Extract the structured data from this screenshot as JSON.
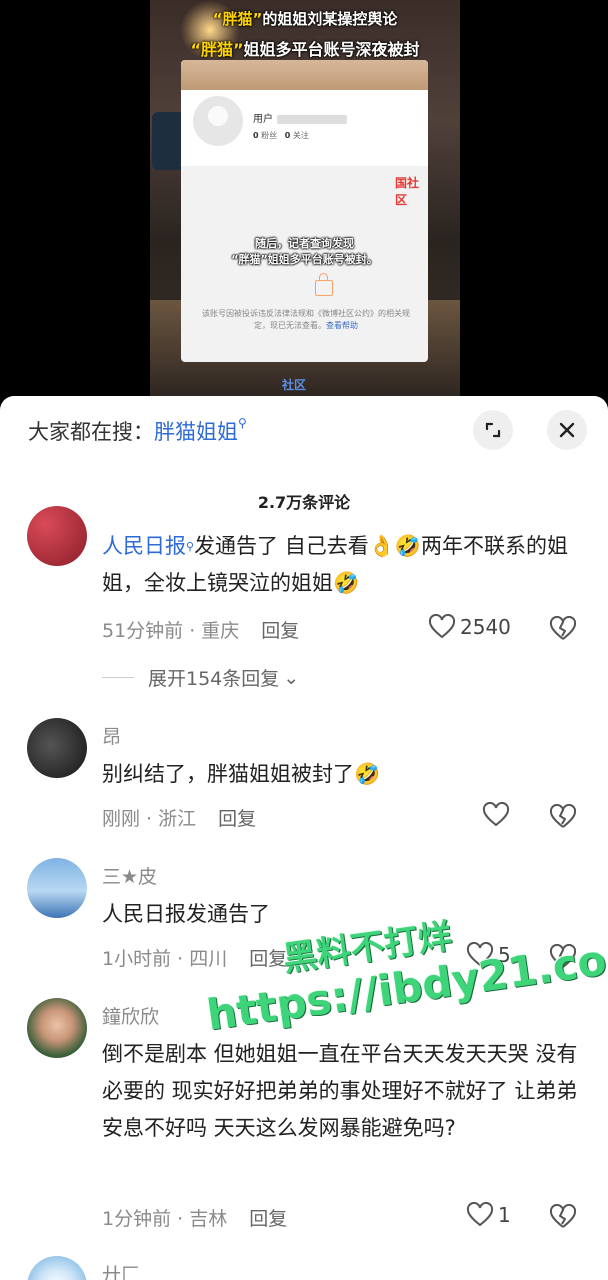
{
  "video": {
    "headline_line1_hl": "“胖猫”",
    "headline_line1_rest": "的姐姐刘某操控舆论",
    "headline_line2_hl": "“胖猫”",
    "headline_line2_rest": "姐姐多平台账号深夜被封",
    "card_user_label": "用户",
    "card_followers": "0",
    "card_followers_label": "粉丝",
    "card_following": "0",
    "card_following_label": "关注",
    "card_logo": "国社区",
    "card_subtitle_line1": "随后，记者查询发现",
    "card_subtitle_line2": "“胖猫”姐姐多平台账号被封。",
    "card_notice": "该账号因被投诉违反法律法规和《微博社区公约》的相关规定，现已无法查看。",
    "card_notice_link": "查看帮助",
    "bottom_mark": "社区"
  },
  "search": {
    "prefix": "大家都在搜：",
    "keyword": "胖猫姐姐"
  },
  "comments_count": "2.7万条评论",
  "comments": [
    {
      "name": "人民日报",
      "text": "发通告了 自己去看👌🤣两年不联系的姐姐，全妆上镜哭泣的姐姐🤣",
      "time_location": "51分钟前 · 重庆",
      "reply": "回复",
      "likes": "2540",
      "expand": "展开154条回复"
    },
    {
      "name": "昂",
      "text": "别纠结了，胖猫姐姐被封了🤣",
      "time_location": "刚刚 · 浙江",
      "reply": "回复",
      "likes": ""
    },
    {
      "name": "三★皮",
      "text": "人民日报发通告了",
      "time_location": "1小时前 · 四川",
      "reply": "回复",
      "likes": "5"
    },
    {
      "name": "鐘欣欣",
      "text": "倒不是剧本 但她姐姐一直在平台天天发天天哭 没有必要的 现实好好把弟弟的事处理好不就好了 让弟弟安息不好吗 天天这么发网暴能避免吗?",
      "time_location": "1分钟前 · 吉林",
      "reply": "回复",
      "likes": "1"
    },
    {
      "name": "廾匚",
      "text": "",
      "time_location": "",
      "reply": "",
      "likes": ""
    }
  ],
  "watermark": {
    "line1": "黑料不打烊",
    "line2": "https://ibdy21.com"
  }
}
